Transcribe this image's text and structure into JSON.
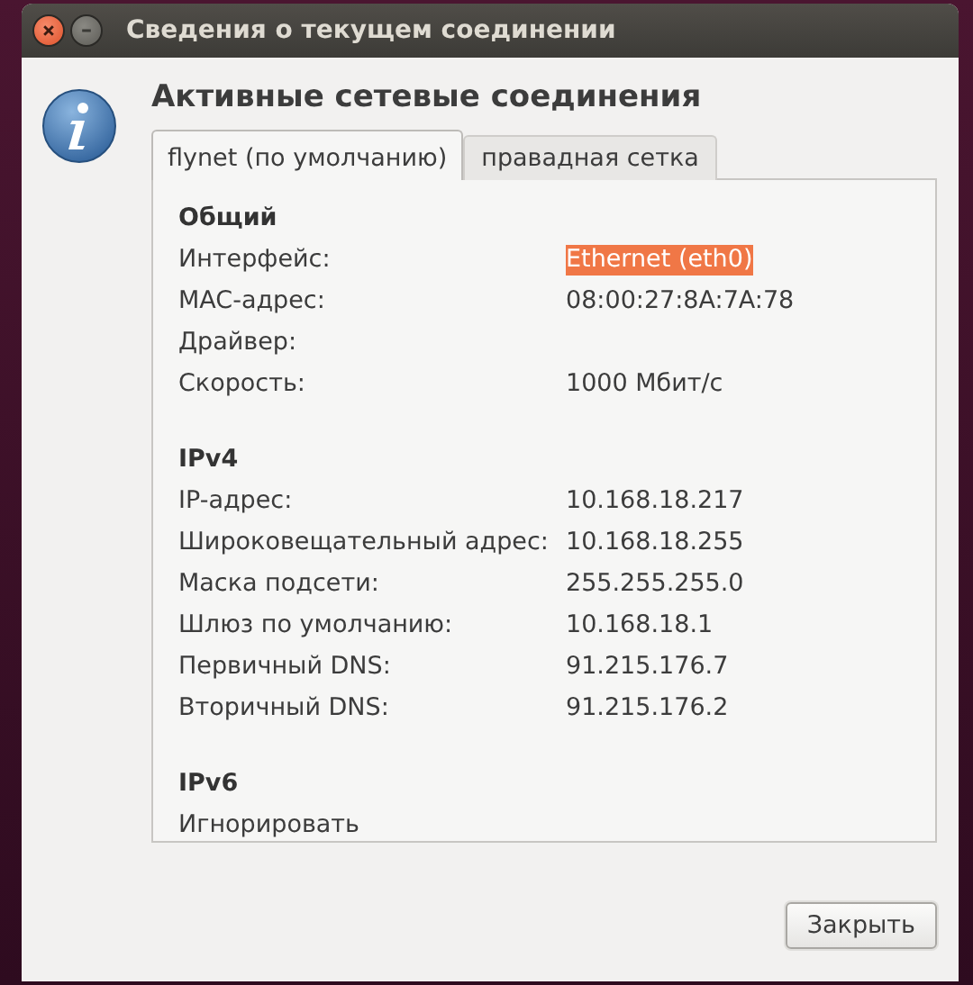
{
  "window": {
    "title": "Сведения о текущем соединении"
  },
  "heading": "Активные сетевые соединения",
  "tabs": [
    {
      "label": "flynet (по умолчанию)",
      "selected": true
    },
    {
      "label": "правадная сетка",
      "selected": false
    }
  ],
  "sections": [
    {
      "title": "Общий",
      "rows": [
        {
          "label": "Интерфейс:",
          "value": "Ethernet (eth0)",
          "highlighted": true
        },
        {
          "label": "MAC-адрес:",
          "value": "08:00:27:8A:7A:78",
          "highlighted": false
        },
        {
          "label": "Драйвер:"
        },
        {
          "label": "Скорость:",
          "value": "1000 Мбит/с",
          "highlighted": false
        }
      ]
    },
    {
      "title": "IPv4",
      "rows": [
        {
          "label": "IP-адрес:",
          "value": "10.168.18.217",
          "highlighted": false
        },
        {
          "label": "Широковещательный адрес:",
          "value": "10.168.18.255",
          "highlighted": false
        },
        {
          "label": "Маска подсети:",
          "value": "255.255.255.0",
          "highlighted": false
        },
        {
          "label": "Шлюз по умолчанию:",
          "value": "10.168.18.1",
          "highlighted": false
        },
        {
          "label": "Первичный DNS:",
          "value": "91.215.176.7",
          "highlighted": false
        },
        {
          "label": "Вторичный DNS:",
          "value": "91.215.176.2",
          "highlighted": false
        }
      ]
    },
    {
      "title": "IPv6",
      "rows": [
        {
          "label": "Игнорировать"
        }
      ]
    }
  ],
  "buttons": [
    "Закрыть"
  ]
}
